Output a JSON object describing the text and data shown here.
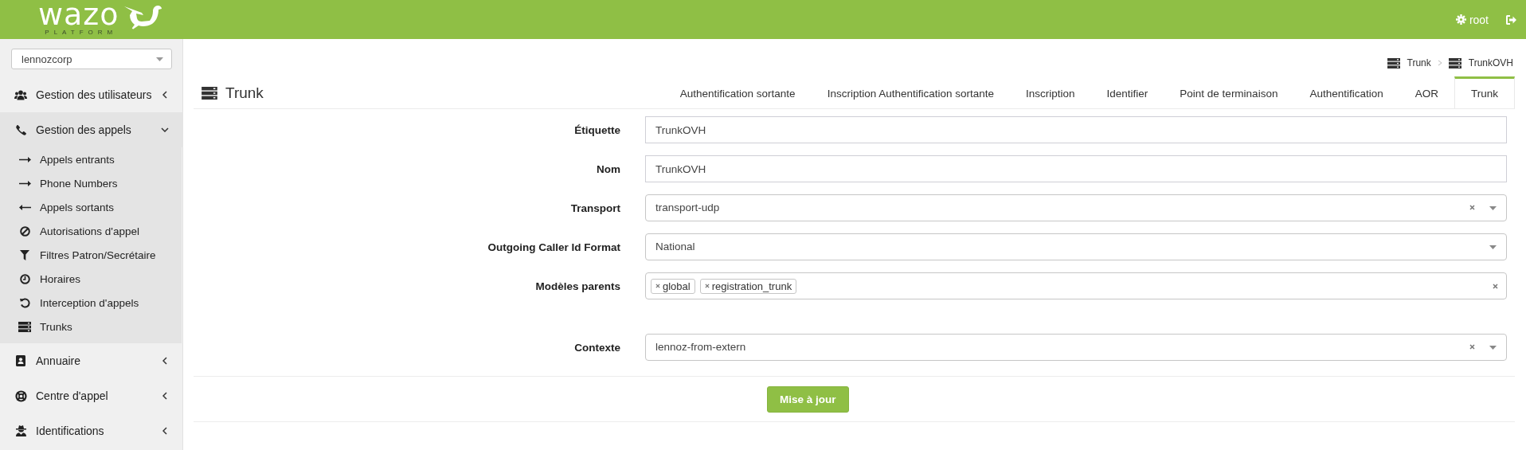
{
  "header": {
    "logo_text": "wazo",
    "logo_subtitle": "PLATFORM",
    "user": "root"
  },
  "sidebar": {
    "tenant": "lennozcorp",
    "groups": [
      {
        "label": "Gestion des utilisateurs",
        "expanded": false
      },
      {
        "label": "Gestion des appels",
        "expanded": true,
        "children": [
          {
            "label": "Appels entrants"
          },
          {
            "label": "Phone Numbers"
          },
          {
            "label": "Appels sortants"
          },
          {
            "label": "Autorisations d'appel"
          },
          {
            "label": "Filtres Patron/Secrétaire"
          },
          {
            "label": "Horaires"
          },
          {
            "label": "Interception d'appels"
          },
          {
            "label": "Trunks"
          }
        ]
      },
      {
        "label": "Annuaire",
        "expanded": false
      },
      {
        "label": "Centre d'appel",
        "expanded": false
      },
      {
        "label": "Identifications",
        "expanded": false
      }
    ]
  },
  "breadcrumb": [
    "Trunk",
    "TrunkOVH"
  ],
  "page_title": "Trunk",
  "tabs": [
    {
      "label": "Authentification sortante",
      "selected": false
    },
    {
      "label": "Inscription Authentification sortante",
      "selected": false
    },
    {
      "label": "Inscription",
      "selected": false
    },
    {
      "label": "Identifier",
      "selected": false
    },
    {
      "label": "Point de terminaison",
      "selected": false
    },
    {
      "label": "Authentification",
      "selected": false
    },
    {
      "label": "AOR",
      "selected": false
    },
    {
      "label": "Trunk",
      "selected": true
    }
  ],
  "form": {
    "fields": [
      {
        "label": "Étiquette",
        "kind": "text",
        "value": "TrunkOVH"
      },
      {
        "label": "Nom",
        "kind": "text",
        "value": "TrunkOVH"
      },
      {
        "label": "Transport",
        "kind": "select",
        "value": "transport-udp",
        "clearable": true
      },
      {
        "label": "Outgoing Caller Id Format",
        "kind": "select",
        "value": "National",
        "clearable": false
      },
      {
        "label": "Modèles parents",
        "kind": "tags",
        "tags": [
          "global",
          "registration_trunk"
        ],
        "clearable": true
      },
      {
        "label": "Contexte",
        "kind": "select",
        "value": "lennoz-from-extern",
        "clearable": true
      }
    ],
    "submit": "Mise à jour"
  }
}
